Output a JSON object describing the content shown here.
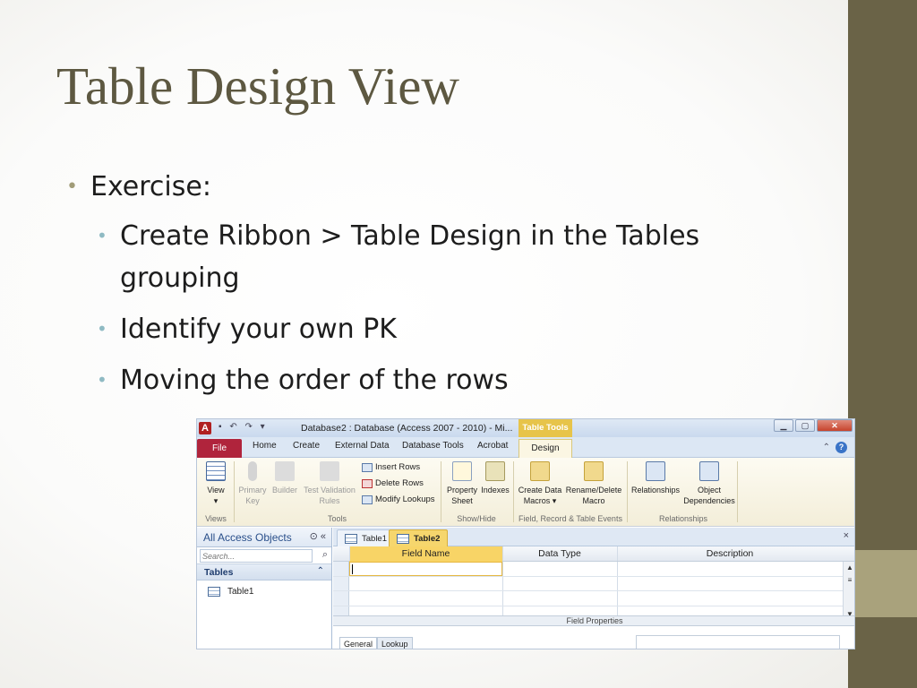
{
  "slide": {
    "title": "Table Design View",
    "bullets": {
      "main": "Exercise:",
      "sub": [
        "Create Ribbon > Table Design in the Tables grouping",
        "Identify your own PK",
        "Moving the order of the rows"
      ]
    },
    "colors": {
      "title": "#5d5841",
      "side_bar": "#6a6347",
      "side_accent": "#a9a27c",
      "sub_bullet": "#8fbac3"
    }
  },
  "access": {
    "app_icon": "A",
    "window_title": "Database2 : Database (Access 2007 - 2010) - Mi...",
    "context_tab": "Table Tools",
    "tabs": [
      "File",
      "Home",
      "Create",
      "External Data",
      "Database Tools",
      "Acrobat",
      "Design"
    ],
    "ribbon": {
      "view_label": "View",
      "view_arrow": "▾",
      "primary_key": [
        "Primary",
        "Key"
      ],
      "builder": "Builder",
      "test_validation": [
        "Test Validation",
        "Rules"
      ],
      "insert_rows": "Insert Rows",
      "delete_rows": "Delete Rows",
      "modify_lookups": "Modify Lookups",
      "property_sheet": [
        "Property",
        "Sheet"
      ],
      "indexes": "Indexes",
      "create_data_macros": [
        "Create Data",
        "Macros ▾"
      ],
      "rename_delete_macro": [
        "Rename/Delete",
        "Macro"
      ],
      "relationships": "Relationships",
      "object_dependencies": [
        "Object",
        "Dependencies"
      ],
      "groups": [
        "Views",
        "Tools",
        "Show/Hide",
        "Field, Record & Table Events",
        "Relationships"
      ]
    },
    "nav": {
      "header": "All Access Objects",
      "search_placeholder": "Search...",
      "group": "Tables",
      "items": [
        "Table1"
      ]
    },
    "doc_tabs": [
      "Table1",
      "Table2"
    ],
    "grid_columns": [
      "Field Name",
      "Data Type",
      "Description"
    ],
    "field_properties": "Field Properties",
    "prop_tabs": [
      "General",
      "Lookup"
    ]
  }
}
